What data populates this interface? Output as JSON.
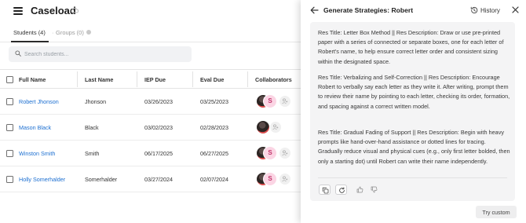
{
  "header": {
    "title": "Caseload"
  },
  "tabs": {
    "students": "Students (4)",
    "separator": "·",
    "groups": "Groups (0)"
  },
  "search": {
    "placeholder": "Search students..."
  },
  "table": {
    "columns": [
      "Full Name",
      "Last Name",
      "IEP Due",
      "Eval Due",
      "Collaborators"
    ],
    "rows": [
      {
        "full_name": "Robert Jhonson",
        "last_name": "Jhonson",
        "iep_due": "03/26/2023",
        "eval_due": "03/25/2023",
        "collaborators": [
          "photo",
          "S"
        ]
      },
      {
        "full_name": "Mason Black",
        "last_name": "Black",
        "iep_due": "03/02/2023",
        "eval_due": "02/28/2023",
        "collaborators": [
          "photo"
        ]
      },
      {
        "full_name": "Winston Smith",
        "last_name": "Smith",
        "iep_due": "06/17/2025",
        "eval_due": "06/27/2025",
        "collaborators": [
          "photo",
          "S"
        ]
      },
      {
        "full_name": "Holly Somerhalder",
        "last_name": "Somerhalder",
        "iep_due": "03/27/2024",
        "eval_due": "02/07/2024",
        "collaborators": [
          "photo",
          "S"
        ]
      }
    ]
  },
  "drawer": {
    "title": "Generate Strategies: Robert",
    "history_label": "History",
    "strategies": [
      "Res Title: Letter Box Method || Res Description: Draw or use pre-printed paper with a series of connected or separate boxes, one for each letter of Robert's name, to help ensure correct letter order and consistent sizing within the designated space.",
      "Res Title: Verbalizing and Self-Correction || Res Description: Encourage Robert to verbally say each letter as they write it. After writing, prompt them to review their name by pointing to each letter, checking its order, formation, and spacing against a correct written model.",
      "Res Title: Gradual Fading of Support || Res Description: Begin with heavy prompts like hand-over-hand assistance or dotted lines for tracing. Gradually reduce visual and physical cues (e.g., only first letter bolded, then only a starting dot) until Robert can write their name independently."
    ],
    "try_custom_label": "Try custom"
  },
  "colors": {
    "link": "#1c6fd1",
    "avatar_s_bg": "#fbd5e4",
    "avatar_s_text": "#c1356b",
    "card_bg": "#f4f4f5"
  },
  "icons": [
    "hamburger-icon",
    "cloud-icon",
    "gear-icon",
    "search-icon",
    "user-add-icon",
    "back-arrow-icon",
    "history-icon",
    "close-icon",
    "copy-icon",
    "refresh-icon",
    "thumbs-up-icon",
    "thumbs-down-icon"
  ]
}
